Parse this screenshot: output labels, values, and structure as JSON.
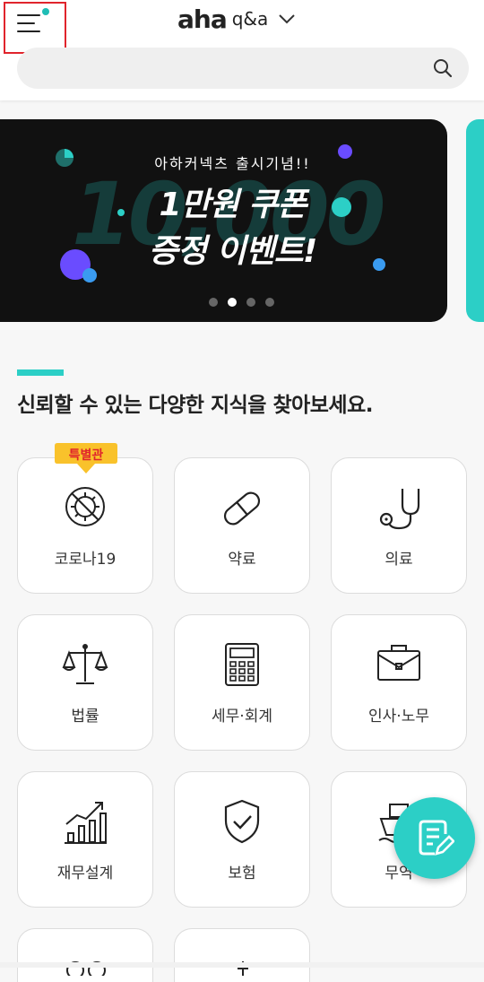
{
  "header": {
    "logo_brand": "aha",
    "logo_suffix": "q&a",
    "search_placeholder": ""
  },
  "banner": {
    "subtitle": "아하커넥츠 출시기념!!",
    "title_line1": "1만원 쿠폰",
    "title_line2": "증정 이벤트!",
    "ghost_text": "10,000",
    "slides_total": 4,
    "active_slide": 2
  },
  "section": {
    "title": "신뢰할 수 있는 다양한 지식을 찾아보세요."
  },
  "categories": [
    {
      "label": "코로나19",
      "icon": "virus-icon",
      "badge": "특별관"
    },
    {
      "label": "약료",
      "icon": "pill-icon"
    },
    {
      "label": "의료",
      "icon": "stethoscope-icon"
    },
    {
      "label": "법률",
      "icon": "scales-icon"
    },
    {
      "label": "세무·회계",
      "icon": "calculator-icon"
    },
    {
      "label": "인사·노무",
      "icon": "briefcase-icon"
    },
    {
      "label": "재무설계",
      "icon": "growth-chart-icon"
    },
    {
      "label": "보험",
      "icon": "shield-check-icon"
    },
    {
      "label": "무역",
      "icon": "ship-icon"
    }
  ],
  "fab": {
    "icon": "write-question-icon"
  },
  "colors": {
    "accent": "#2ccfc6",
    "highlight": "#e0242c",
    "banner_bg": "#111111",
    "badge": "#f9c22b"
  }
}
